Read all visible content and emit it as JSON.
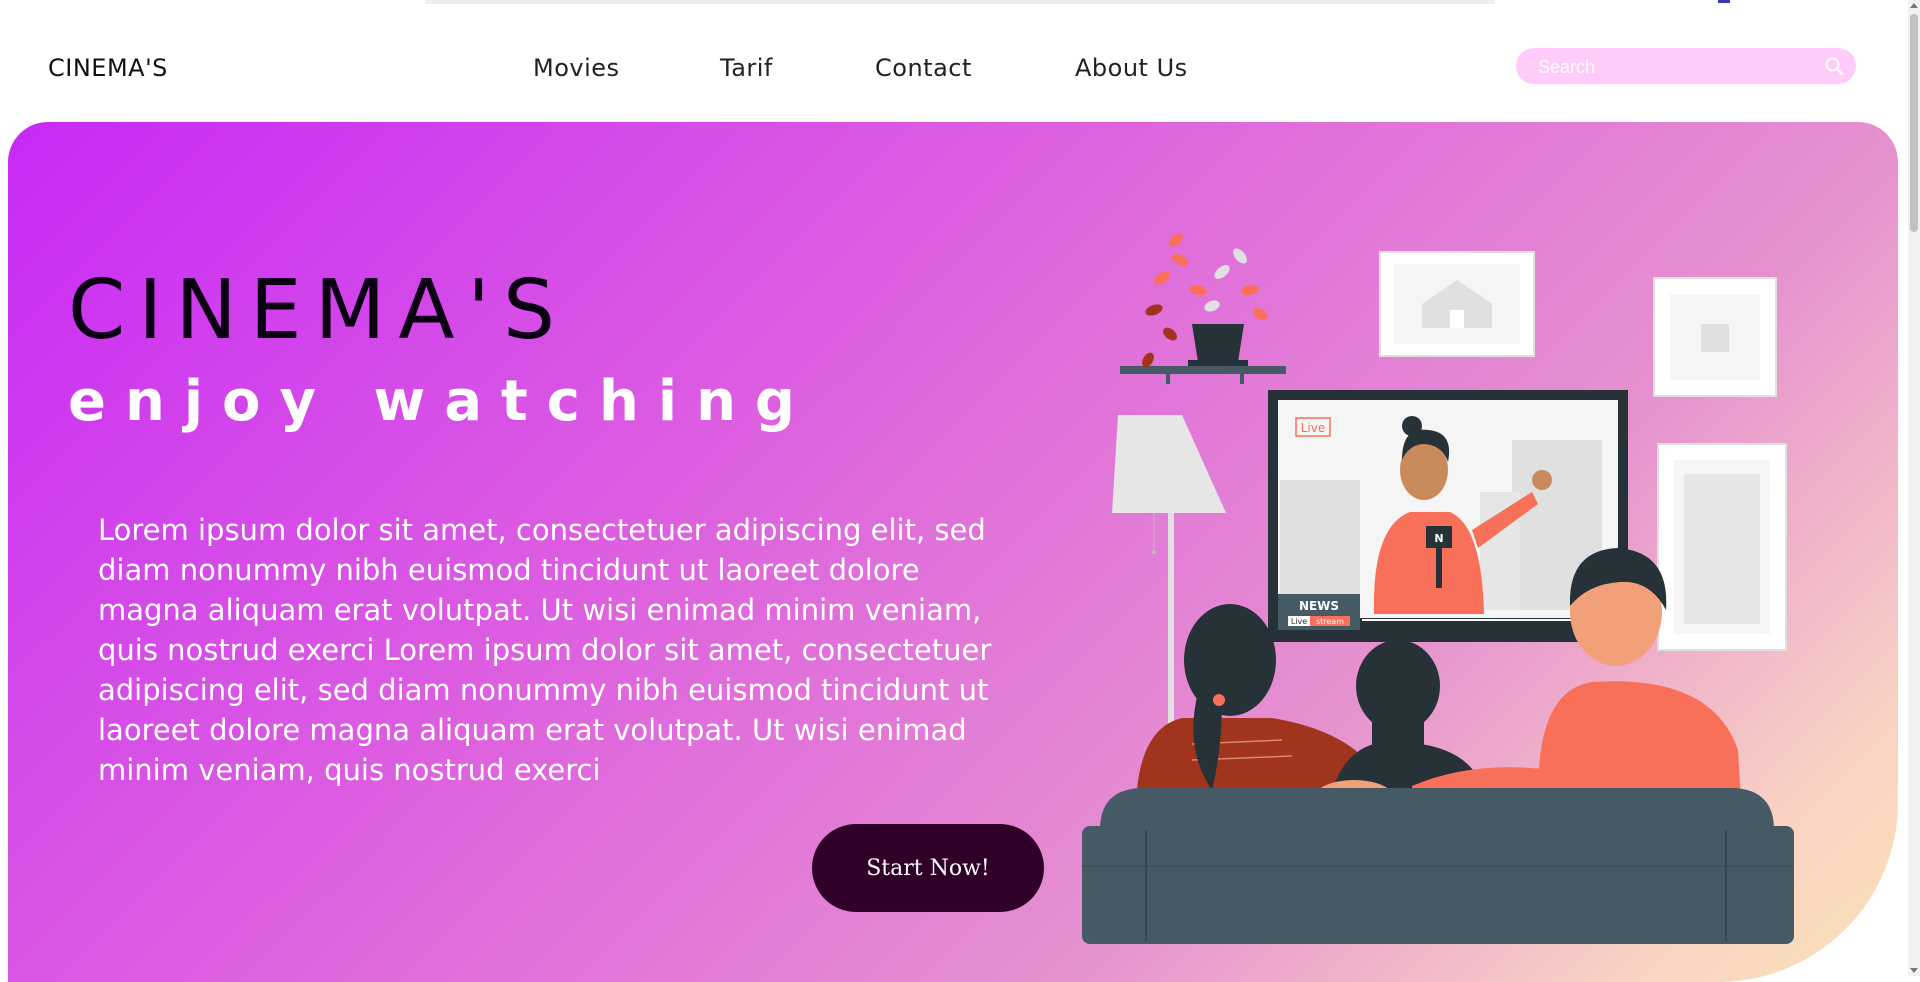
{
  "header": {
    "logo": "CINEMA'S",
    "nav": [
      "Movies",
      "Tarif",
      "Contact",
      "About Us"
    ],
    "search_placeholder": "Search",
    "search_icon": "search-icon"
  },
  "hero": {
    "title": "CINEMA'S",
    "subtitle": "enjoy watching",
    "description": "Lorem ipsum dolor sit amet, consectetuer adipiscing elit, sed diam nonummy nibh euismod tincidunt ut laoreet dolore magna aliquam erat volutpat. Ut wisi enimad minim veniam, quis nostrud exerci Lorem ipsum dolor sit amet, consectetuer adipiscing elit, sed diam nonummy nibh euismod tincidunt ut laoreet dolore magna aliquam erat volutpat. Ut wisi enimad minim veniam, quis nostrud exerci",
    "cta_label": "Start Now!"
  },
  "illustration": {
    "tv_live": "Live",
    "tv_news": "NEWS",
    "tv_stream_live": "Live",
    "tv_stream": "stream",
    "mic_letter": "N"
  },
  "colors": {
    "hero_gradient_start": "#c729f6",
    "hero_gradient_end": "#fbe3b6",
    "cta_background": "#310028",
    "search_background": "#ffccfa",
    "shirt": "#f9705a",
    "sofa": "#455a64"
  }
}
